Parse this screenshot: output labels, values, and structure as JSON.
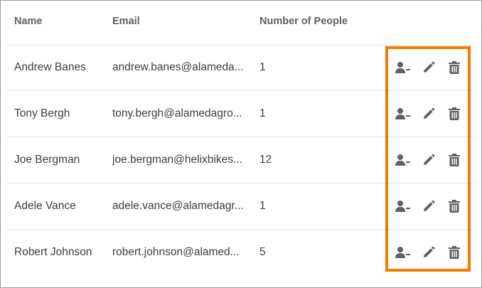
{
  "table": {
    "columns": {
      "name": "Name",
      "email": "Email",
      "count": "Number of People"
    },
    "rows": [
      {
        "name": "Andrew Banes",
        "email": "andrew.banes@alameda...",
        "count": "1"
      },
      {
        "name": "Tony Bergh",
        "email": "tony.bergh@alamedagro...",
        "count": "1"
      },
      {
        "name": "Joe Bergman",
        "email": "joe.bergman@helixbikes...",
        "count": "12"
      },
      {
        "name": "Adele Vance",
        "email": "adele.vance@alamedagr...",
        "count": "1"
      },
      {
        "name": "Robert Johnson",
        "email": "robert.johnson@alamed...",
        "count": "5"
      }
    ]
  },
  "row_actions": [
    "remove-person-icon",
    "edit-icon",
    "delete-icon"
  ],
  "colors": {
    "highlight": "#f57c00",
    "icon": "#616161",
    "border": "#9e9e9e"
  }
}
